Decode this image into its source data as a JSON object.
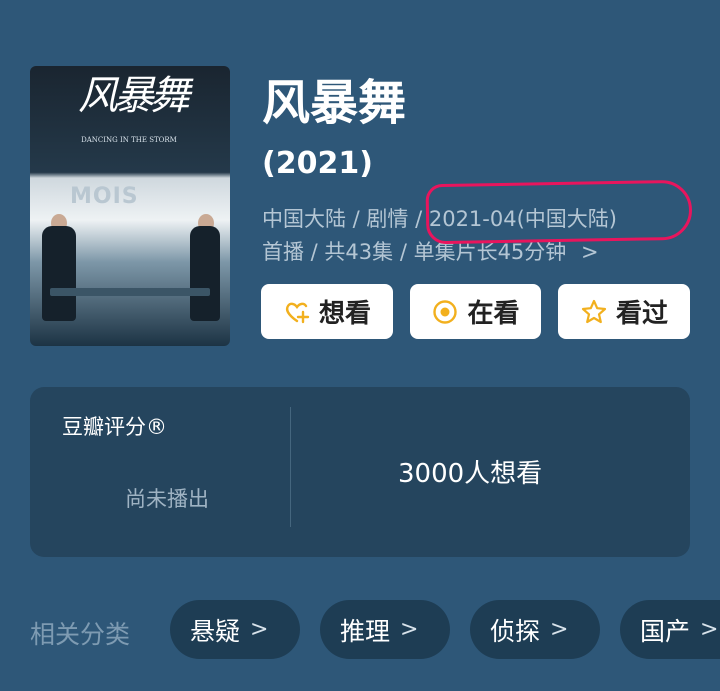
{
  "poster": {
    "title_art": "风暴舞",
    "subtitle_art": "DANCING IN THE STORM",
    "logo_art": "MOIS"
  },
  "title": "风暴舞",
  "year": "(2021)",
  "meta_line1": "中国大陆 / 剧情 / 2021-04(中国大陆)",
  "meta_line2": "首播 / 共43集 / 单集片长45分钟",
  "meta_chevron": ">",
  "buttons": {
    "want": "想看",
    "watching": "在看",
    "watched": "看过"
  },
  "rating": {
    "label": "豆瓣评分®",
    "status": "尚未播出",
    "want_count": "3000人想看"
  },
  "tags": {
    "label": "相关分类",
    "items": [
      "悬疑",
      "推理",
      "侦探",
      "国产"
    ],
    "chevron": ">"
  },
  "colors": {
    "background": "#2e5778",
    "card": "#25455e",
    "accent_yellow": "#f2b01e",
    "annotation_red": "#e8155d"
  },
  "icons": {
    "want": "heart-plus-icon",
    "watching": "target-circle-icon",
    "watched": "star-icon"
  }
}
